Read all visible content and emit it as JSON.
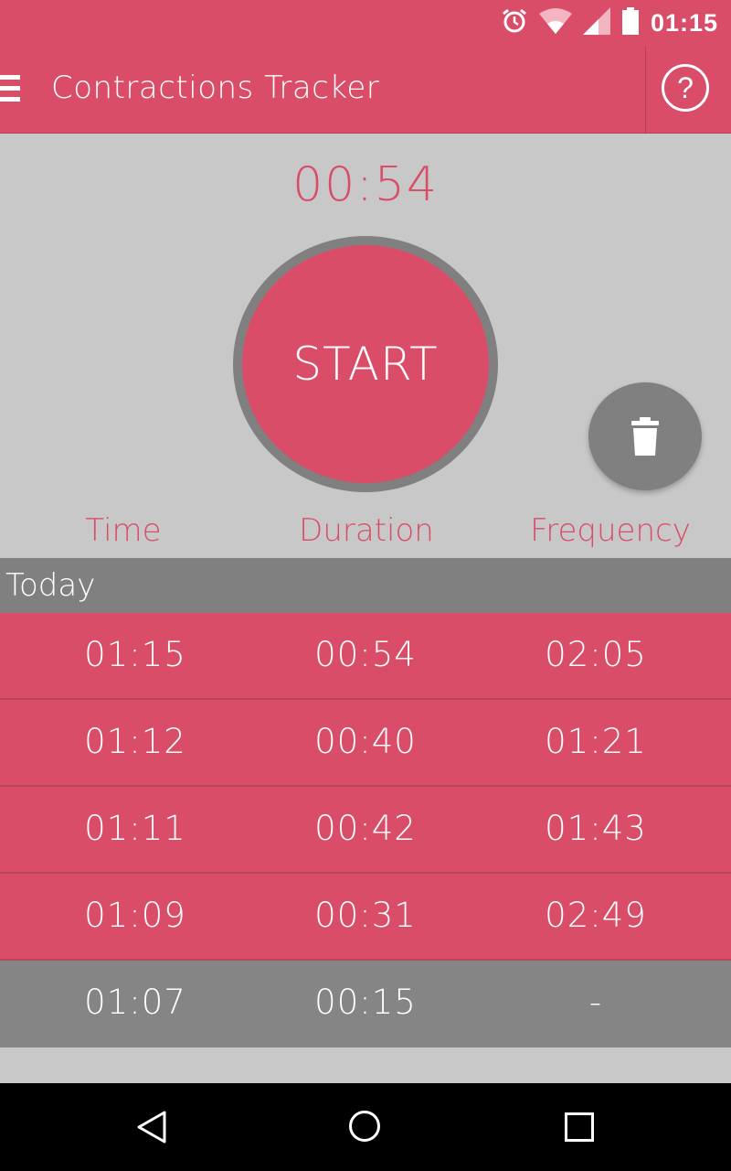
{
  "status_bar": {
    "time": "01:15",
    "icons": [
      "alarm-icon",
      "wifi-icon",
      "cell-signal-icon",
      "battery-icon"
    ]
  },
  "app_bar": {
    "title": "Contractions Tracker",
    "menu_icon": "menu-icon",
    "help_label": "?"
  },
  "timer": {
    "elapsed": "00:54"
  },
  "start_button": {
    "label": "START"
  },
  "delete_button": {
    "icon": "trash-icon"
  },
  "columns": {
    "time": "Time",
    "duration": "Duration",
    "frequency": "Frequency"
  },
  "section": {
    "label": "Today"
  },
  "rows": [
    {
      "time": "01:15",
      "duration": "00:54",
      "frequency": "02:05"
    },
    {
      "time": "01:12",
      "duration": "00:40",
      "frequency": "01:21"
    },
    {
      "time": "01:11",
      "duration": "00:42",
      "frequency": "01:43"
    },
    {
      "time": "01:09",
      "duration": "00:31",
      "frequency": "02:49"
    },
    {
      "time": "01:07",
      "duration": "00:15",
      "frequency": "-"
    }
  ],
  "colors": {
    "accent": "#d94d68",
    "gray": "#808080",
    "background": "#c8c8c8"
  },
  "nav_bar": {
    "icons": [
      "back-icon",
      "home-icon",
      "recents-icon"
    ]
  }
}
